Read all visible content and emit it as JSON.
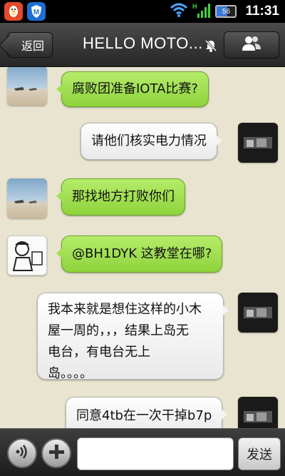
{
  "status_bar": {
    "time": "11:31",
    "battery_label": "56",
    "battery_level": 0.56,
    "apps": [
      "qq-penguin-icon",
      "shield-icon"
    ],
    "icons": [
      "wifi-icon",
      "signal-icon",
      "battery-icon"
    ]
  },
  "header": {
    "back_label": "返回",
    "title": "HELLO MOTO...",
    "icons": [
      "mute-icon",
      "contacts-icon"
    ]
  },
  "messages": [
    {
      "side": "left",
      "avatar": "sky",
      "text": "腐败团准备IOTA比赛?"
    },
    {
      "side": "right",
      "avatar": "dark",
      "text": "请他们核实电力情况"
    },
    {
      "side": "left",
      "avatar": "sky",
      "text": "那找地方打败你们"
    },
    {
      "side": "left",
      "avatar": "sketch",
      "text": "@BH1DYK 这教堂在哪?"
    },
    {
      "side": "right",
      "avatar": "dark",
      "text": "我本来就是想住这样的小木\n屋一周的，，，结果上岛无\n电台，有电台无上\n岛。。。。"
    },
    {
      "side": "right",
      "avatar": "dark",
      "text": "同意4tb在一次干掉b7p"
    }
  ],
  "input_bar": {
    "voice_icon": "voice-icon",
    "add_icon": "plus-icon",
    "input_value": "",
    "send_label": "发送"
  },
  "colors": {
    "background": "#e9e4cf",
    "bubble_green": "#9edc4a",
    "bubble_white": "#f4f4f4",
    "bar_dark": "#2b2b2b"
  }
}
